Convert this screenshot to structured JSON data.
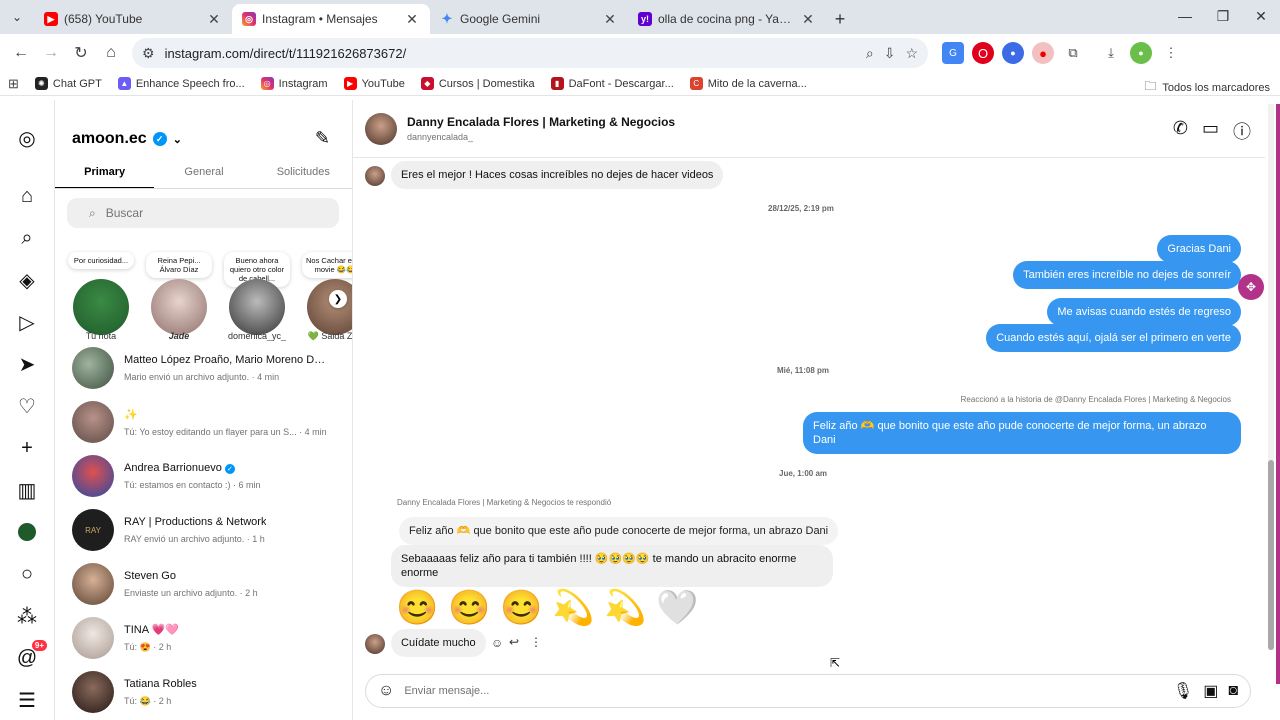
{
  "browser": {
    "tabs": [
      {
        "title": "(658) YouTube",
        "icon": "youtube-icon",
        "color": "#ff0000",
        "active": false
      },
      {
        "title": "Instagram • Mensajes",
        "icon": "instagram-icon",
        "color": "#e1306c",
        "active": true
      },
      {
        "title": "Google Gemini",
        "icon": "gemini-icon",
        "color": "#4285f4",
        "active": false
      },
      {
        "title": "olla de cocina png - Yahoo Sea",
        "icon": "yahoo-icon",
        "color": "#6001d2",
        "active": false
      }
    ],
    "url": "instagram.com/direct/t/111921626873672/",
    "bookmarks": [
      {
        "label": "Chat GPT",
        "icon": "chatgpt-icon",
        "color": "#222222"
      },
      {
        "label": "Enhance Speech fro...",
        "icon": "enhance-icon",
        "color": "#6a5cf5"
      },
      {
        "label": "Instagram",
        "icon": "instagram-icon",
        "color": "#e1306c"
      },
      {
        "label": "YouTube",
        "icon": "youtube-icon",
        "color": "#ff0000"
      },
      {
        "label": "Cursos | Domestika",
        "icon": "domestika-icon",
        "color": "#c8102e"
      },
      {
        "label": "DaFont - Descargar...",
        "icon": "dafont-icon",
        "color": "#b5121b"
      },
      {
        "label": "Mito de la caverna...",
        "icon": "mito-icon",
        "color": "#d9432f"
      }
    ],
    "all_bookmarks": "Todos los marcadores"
  },
  "nav": {
    "notifications_badge": "9+"
  },
  "inbox": {
    "account": "amoon.ec",
    "tabs": [
      "Primary",
      "General",
      "Solicitudes"
    ],
    "search_placeholder": "Buscar",
    "notes": [
      {
        "text": "Por curiosidad...",
        "name": "Tu nota",
        "color": "#1f5a2a"
      },
      {
        "text": "Reina Pepi... Álvaro Díaz",
        "name": "Jade",
        "color": "#b89a9a"
      },
      {
        "text": "Bueno ahora quiero otro color de cabell...",
        "name": "domenica_yc_",
        "color": "#555555"
      },
      {
        "text": "Nos Cachar en la movie 😂😂",
        "name": "💚 Saida Zuñ",
        "color": "#7a5b4a"
      }
    ],
    "conversations": [
      {
        "name": "Matteo López Proaño, Mario Moreno Del ...",
        "meta": "Mario envió un archivo adjunto. · 4 min",
        "color": "#6b7d6b"
      },
      {
        "name": "✨",
        "meta": "Tú: Yo estoy editando un flayer para un S... · 4 min",
        "color": "#8a6f68"
      },
      {
        "name": "Andrea Barrionuevo",
        "meta": "Tú: estamos en contacto :) · 6 min",
        "color": "#c03a3a",
        "verified": true
      },
      {
        "name": "RAY | Productions & Network",
        "meta": "RAY envió un archivo adjunto. · 1 h",
        "color": "#1e1e1e"
      },
      {
        "name": "Steven Go",
        "meta": "Enviaste un archivo adjunto. · 2 h",
        "color": "#a57b5e"
      },
      {
        "name": "TINA 💗🩷",
        "meta": "Tú: 😍 · 2 h",
        "color": "#d4c8c2"
      },
      {
        "name": "Tatiana Robles",
        "meta": "Tú: 😂 · 2 h",
        "color": "#3a2a24"
      }
    ]
  },
  "chat": {
    "name": "Danny Encalada Flores | Marketing & Negocios",
    "username": "dannyencalada_",
    "messages": {
      "m1": "Eres el mejor ! Haces cosas increíbles no dejes de hacer videos",
      "ts1": "28/12/25, 2:19 pm",
      "o1": "Gracias Dani",
      "o2": "También eres increíble no dejes de sonreír",
      "o3": "Me avisas cuando estés de regreso",
      "o4": "Cuando estés aquí, ojalá ser el primero en verte",
      "ts2": "Mié, 11:08 pm",
      "story_reply": "Reaccionó a la historia de @Danny Encalada Flores | Marketing & Negocios",
      "o5_line1": "Feliz año 🫶 que bonito que este año pude conocerte de mejor forma, un abrazo",
      "o5_line2": "Dani",
      "ts3": "Jue, 1:00 am",
      "replied": "Danny Encalada Flores | Marketing & Negocios te respondió",
      "quoted": "Feliz año 🫶 que bonito que este año pude conocerte de mejor forma, un abrazo Dani",
      "m2_line1": "Sebaaaaas feliz año para ti también !!!! 🥹🥹🥹🥹 te mando un abracito enorme",
      "m2_line2": "enorme",
      "emojis": [
        "😊",
        "😊",
        "😊",
        "💫",
        "💫",
        "🤍"
      ],
      "m3": "Cuídate mucho"
    },
    "composer_placeholder": "Enviar mensaje..."
  },
  "colors": {
    "accent": "#3797f0",
    "ext": "#b23289"
  }
}
